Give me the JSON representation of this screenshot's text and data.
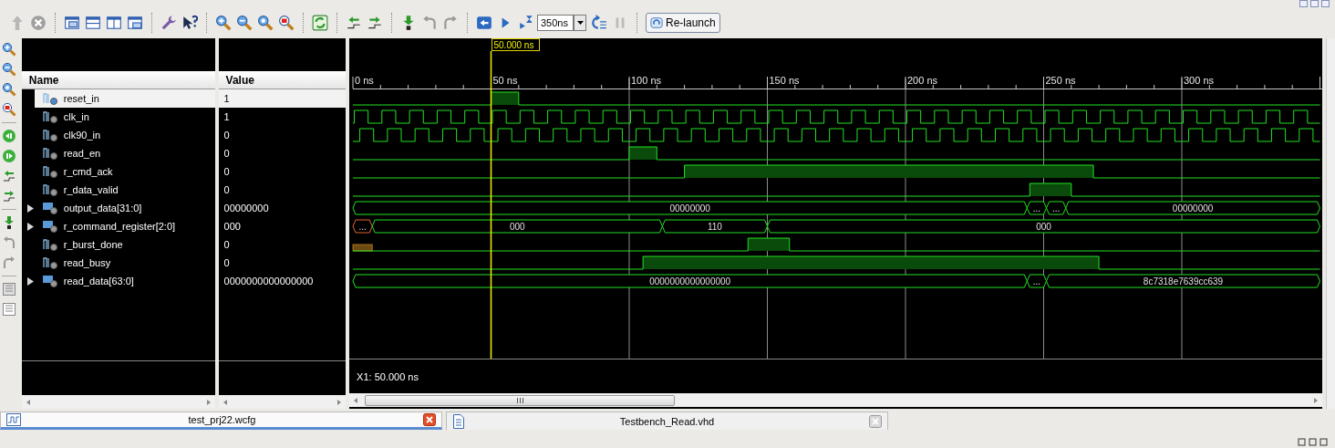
{
  "toolbar": {
    "time_field": {
      "value": "350ns"
    },
    "relaunch_button": {
      "label": "Re-launch"
    }
  },
  "columns": {
    "name": "Name",
    "value": "Value"
  },
  "signals": [
    {
      "name": "reset_in",
      "value": "1",
      "kind": "bit",
      "selected": true
    },
    {
      "name": "clk_in",
      "value": "1",
      "kind": "bit",
      "selected": false
    },
    {
      "name": "clk90_in",
      "value": "0",
      "kind": "bit",
      "selected": false
    },
    {
      "name": "read_en",
      "value": "0",
      "kind": "bit",
      "selected": false
    },
    {
      "name": "r_cmd_ack",
      "value": "0",
      "kind": "bit",
      "selected": false
    },
    {
      "name": "r_data_valid",
      "value": "0",
      "kind": "bit",
      "selected": false
    },
    {
      "name": "output_data[31:0]",
      "value": "00000000",
      "kind": "bus",
      "selected": false,
      "segments": [
        "00000000",
        "...",
        "...",
        "00000000"
      ]
    },
    {
      "name": "r_command_register[2:0]",
      "value": "000",
      "kind": "bus",
      "selected": false,
      "segments": [
        "...",
        "000",
        "110",
        "000"
      ]
    },
    {
      "name": "r_burst_done",
      "value": "0",
      "kind": "bit",
      "selected": false
    },
    {
      "name": "read_busy",
      "value": "0",
      "kind": "bit",
      "selected": false
    },
    {
      "name": "read_data[63:0]",
      "value": "0000000000000000",
      "kind": "bus",
      "selected": false,
      "segments": [
        "0000000000000000",
        "...",
        "8c7318e7639cc639"
      ]
    }
  ],
  "wave": {
    "cursor_label": "50.000 ns",
    "time_labels": [
      "0 ns",
      "50 ns",
      "100 ns",
      "150 ns",
      "200 ns",
      "250 ns",
      "300 ns"
    ],
    "cursor_readout": "X1: 50.000 ns"
  },
  "tabs": [
    {
      "label": "test_prj22.wcfg",
      "selected": true
    },
    {
      "label": "Testbench_Read.vhd",
      "selected": false
    }
  ]
}
